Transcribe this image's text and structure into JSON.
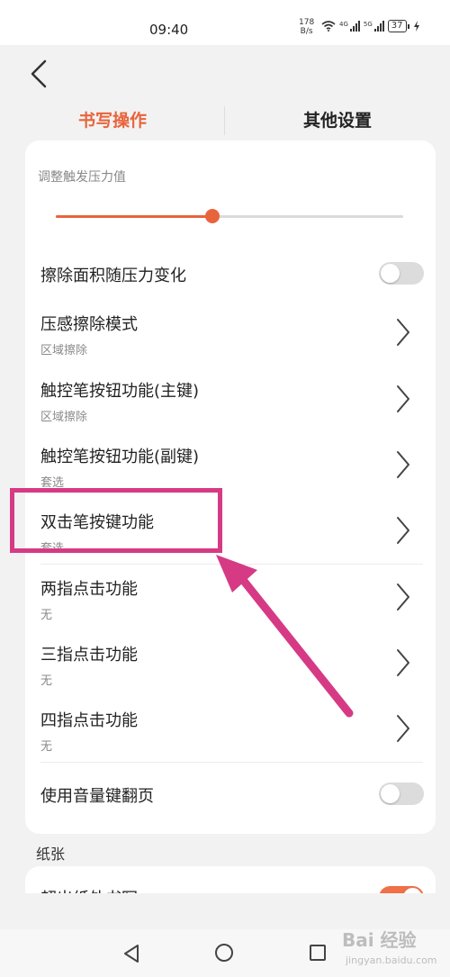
{
  "status": {
    "time": "09:40",
    "net_speed_value": "178",
    "net_speed_unit": "B/s",
    "sig1_tag": "4G",
    "sig2_tag": "5G",
    "battery": "37"
  },
  "tabs": [
    {
      "label": "书写操作",
      "active": true
    },
    {
      "label": "其他设置",
      "active": false
    }
  ],
  "pressure": {
    "label": "调整触发压力值",
    "value_fraction": 0.45
  },
  "settings": {
    "erase_area": {
      "label": "擦除面积随压力变化",
      "on": false
    },
    "pressure_erase": {
      "label": "压感擦除模式",
      "value": "区域擦除"
    },
    "pen_primary": {
      "label": "触控笔按钮功能(主键)",
      "value": "区域擦除"
    },
    "pen_secondary": {
      "label": "触控笔按钮功能(副键)",
      "value": "套选"
    },
    "double_tap_pen": {
      "label": "双击笔按键功能",
      "value": "套选"
    },
    "two_finger": {
      "label": "两指点击功能",
      "value": "无"
    },
    "three_finger": {
      "label": "三指点击功能",
      "value": "无"
    },
    "four_finger": {
      "label": "四指点击功能",
      "value": "无"
    },
    "volume_page": {
      "label": "使用音量键翻页",
      "on": false
    }
  },
  "paper": {
    "section_label": "纸张",
    "first_item_label": "超出纸外书写",
    "first_item_on": true
  },
  "watermark": {
    "text": "Bai 经验",
    "url": "jingyan.baidu.com"
  },
  "colors": {
    "accent": "#e8643c",
    "highlight": "#d63a85"
  }
}
